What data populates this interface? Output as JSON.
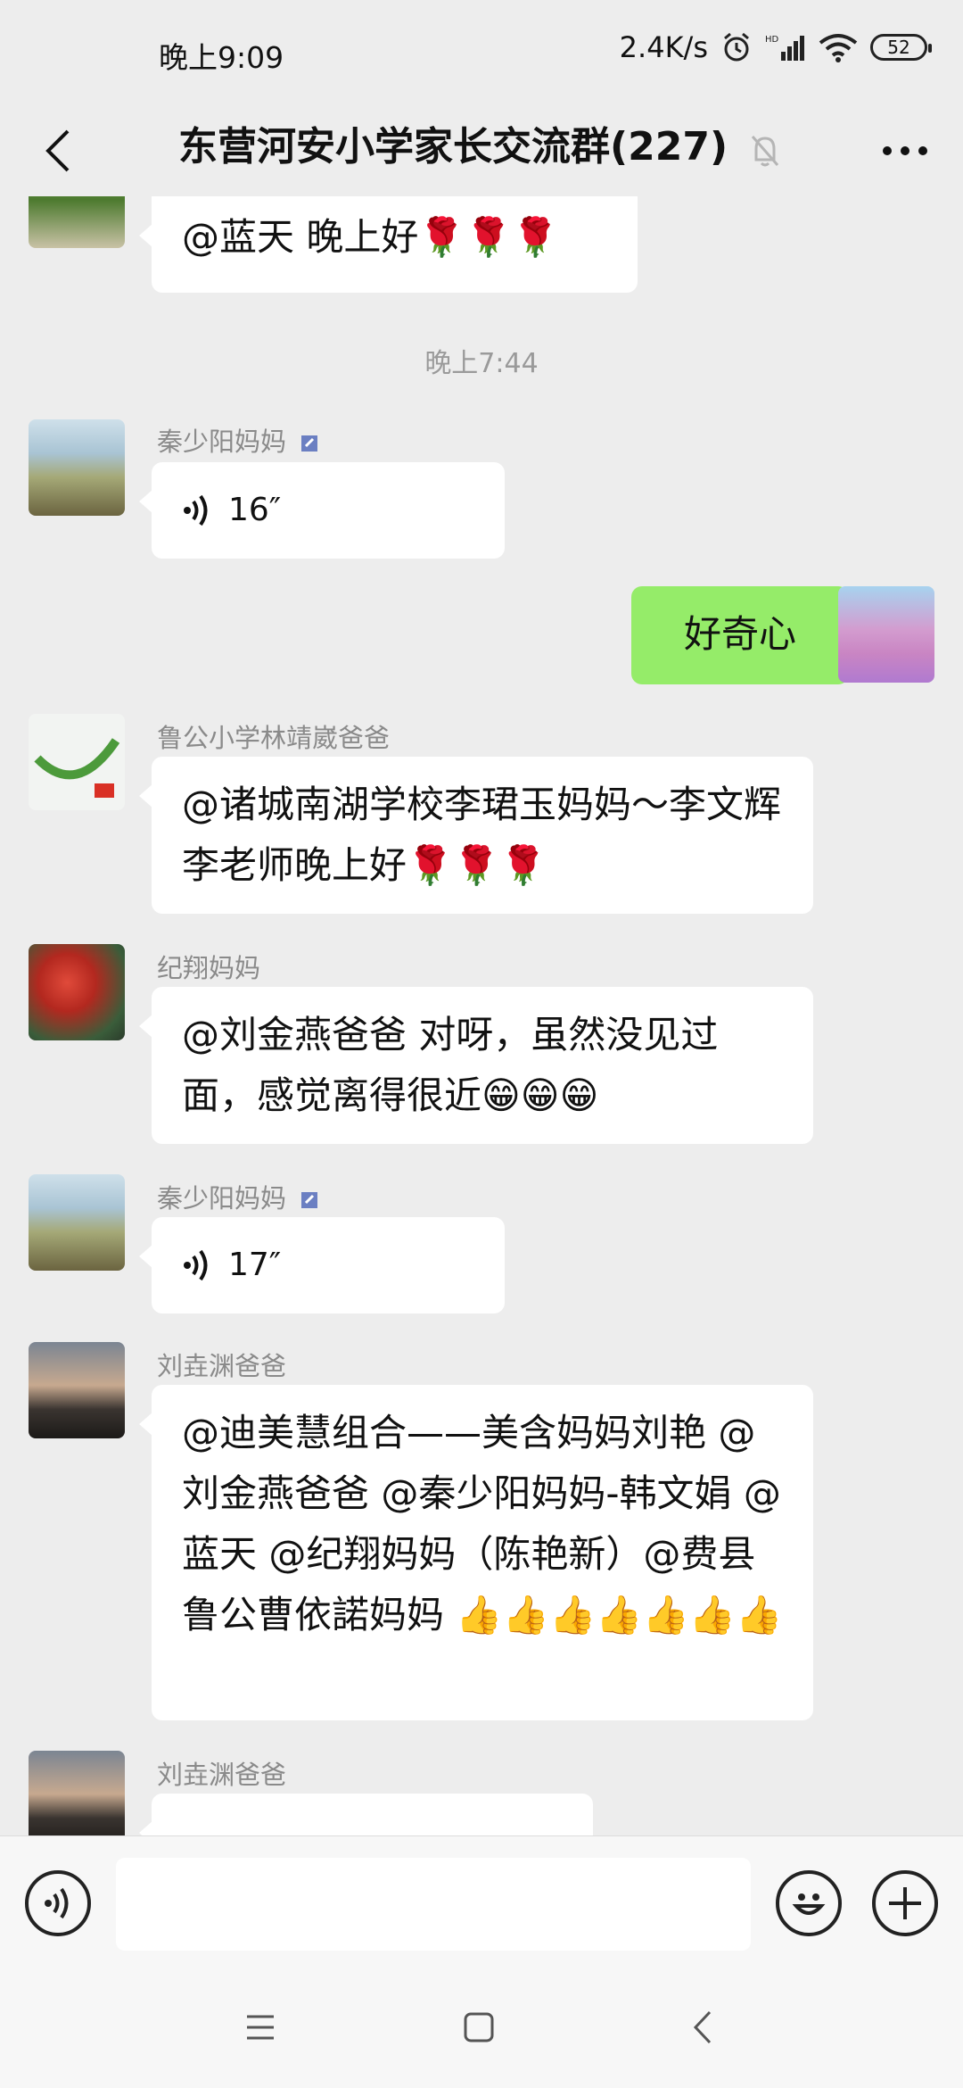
{
  "status_bar": {
    "time": "晚上9:09",
    "speed": "2.4K/s",
    "battery": "52"
  },
  "header": {
    "title": "东营河安小学家长交流群(227)"
  },
  "messages": {
    "top": {
      "text": "@蓝天  晚上好🌹🌹🌹"
    },
    "timestamp": "晚上7:44",
    "m1": {
      "sender": "秦少阳妈妈",
      "duration": "16″"
    },
    "m2": {
      "text": "好奇心"
    },
    "m3": {
      "sender": "鲁公小学林靖崴爸爸",
      "text": "@诸城南湖学校李珺玉妈妈～李文辉  李老师晚上好🌹🌹🌹"
    },
    "m4": {
      "sender": "纪翔妈妈",
      "text": "@刘金燕爸爸  对呀，虽然没见过面，感觉离得很近😁😁😁"
    },
    "m5": {
      "sender": "秦少阳妈妈",
      "duration": "17″"
    },
    "m6": {
      "sender": "刘垚渊爸爸",
      "text": "@迪美慧组合——美含妈妈刘艳 @刘金燕爸爸 @秦少阳妈妈-韩文娟 @蓝天 @纪翔妈妈（陈艳新）@费县鲁公曹依諾妈妈 👍👍👍👍👍👍👍"
    },
    "m7": {
      "sender": "刘垚渊爸爸"
    }
  },
  "colors": {
    "background": "#ededed",
    "bubble_other": "#ffffff",
    "bubble_self": "#95ec69"
  },
  "icons": [
    "back-arrow-icon",
    "mute-bell-icon",
    "more-icon",
    "voice-icon",
    "emoji-icon",
    "plus-icon",
    "menu-icon",
    "home-icon",
    "back-icon"
  ]
}
